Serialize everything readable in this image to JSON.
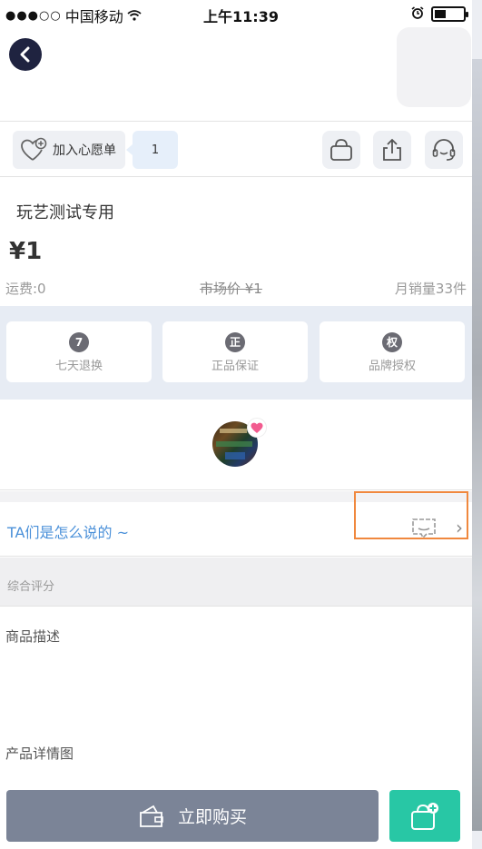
{
  "status_bar": {
    "signal": "●●●○○",
    "carrier": "中国移动",
    "time": "上午11:39"
  },
  "toolbar": {
    "wishlist_label": "加入心愿单",
    "wishlist_count": "1"
  },
  "product": {
    "title": "玩艺测试专用",
    "price": "¥1",
    "shipping": "运费:0",
    "market_price": "市场价 ¥1",
    "monthly_sales": "月销量33件"
  },
  "services": [
    {
      "badge": "7",
      "label": "七天退换"
    },
    {
      "badge": "正",
      "label": "正品保证"
    },
    {
      "badge": "权",
      "label": "品牌授权"
    }
  ],
  "comments": {
    "prompt": "TA们是怎么说的 ~"
  },
  "rating": {
    "label": "综合评分"
  },
  "description": {
    "title": "商品描述",
    "detail_title": "产品详情图"
  },
  "bottom": {
    "buy_label": "立即购买"
  },
  "colors": {
    "accent_link": "#4a90d9",
    "buy_button": "#7b8497",
    "cart_button": "#28c7a5",
    "highlight": "#f0883e",
    "heart": "#f25b8f"
  }
}
